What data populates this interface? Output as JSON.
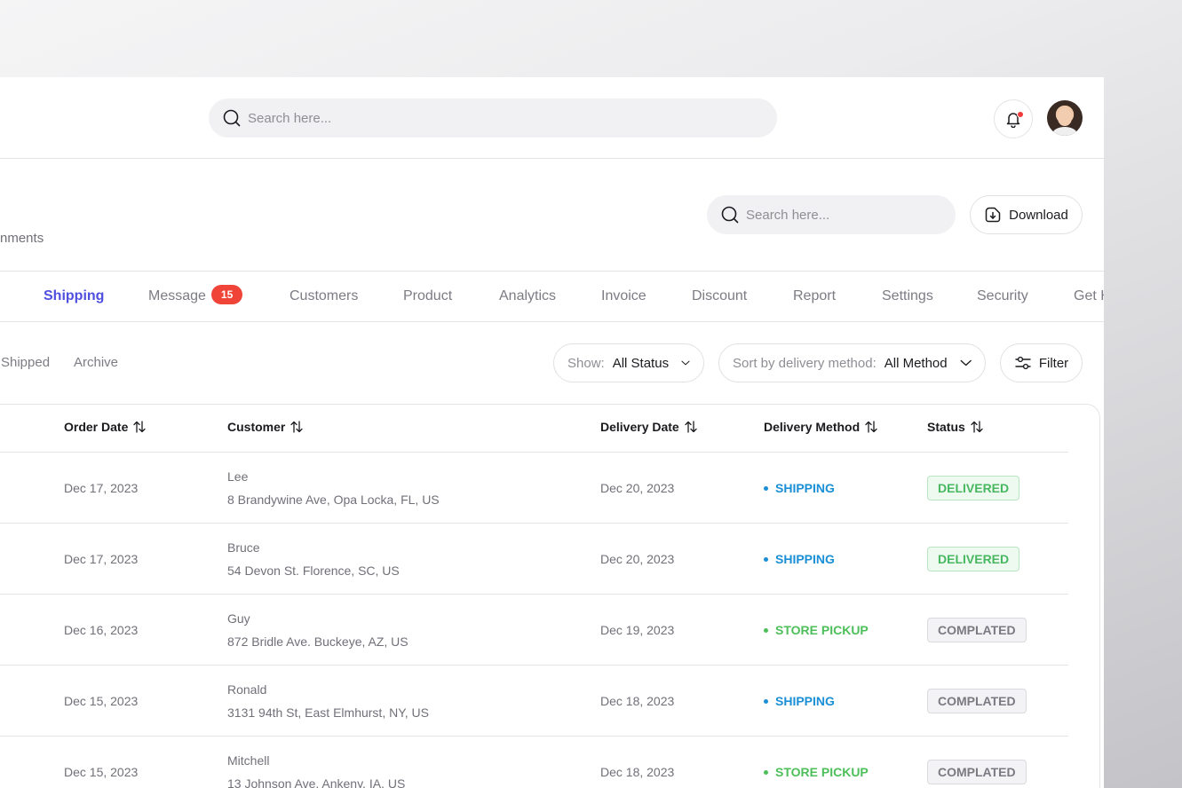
{
  "topbar": {
    "search_placeholder": "Search here...",
    "icons": {
      "search": "search-icon",
      "notification": "bell-icon",
      "avatar": "user-avatar"
    },
    "notification_dot_color": "#ef3b3b"
  },
  "header": {
    "subtitle": "nments",
    "search_placeholder": "Search here...",
    "download_label": "Download"
  },
  "tabs": [
    {
      "label": "Shipping",
      "active": true
    },
    {
      "label": "Message",
      "badge": "15"
    },
    {
      "label": "Customers"
    },
    {
      "label": "Product"
    },
    {
      "label": "Analytics"
    },
    {
      "label": "Invoice"
    },
    {
      "label": "Discount"
    },
    {
      "label": "Report"
    },
    {
      "label": "Settings"
    },
    {
      "label": "Security"
    },
    {
      "label": "Get H"
    }
  ],
  "subtabs": [
    "Shipped",
    "Archive"
  ],
  "filters": {
    "show_label": "Show:",
    "show_value": "All Status",
    "sort_label": "Sort by delivery method:",
    "sort_value": "All Method",
    "filter_label": "Filter"
  },
  "table": {
    "columns": [
      "Order Date",
      "Customer",
      "Delivery Date",
      "Delivery Method",
      "Status"
    ],
    "rows": [
      {
        "order_date": "Dec 17, 2023",
        "customer": "Lee",
        "address": "8 Brandywine Ave, Opa Locka, FL, US",
        "delivery_date": "Dec 20, 2023",
        "method": "SHIPPING",
        "status": "DELIVERED"
      },
      {
        "order_date": "Dec 17, 2023",
        "customer": "Bruce",
        "address": "54 Devon St. Florence, SC, US",
        "delivery_date": "Dec 20, 2023",
        "method": "SHIPPING",
        "status": "DELIVERED"
      },
      {
        "order_date": "Dec 16, 2023",
        "customer": "Guy",
        "address": "872 Bridle Ave. Buckeye, AZ, US",
        "delivery_date": "Dec 19, 2023",
        "method": "STORE PICKUP",
        "status": "COMPLATED"
      },
      {
        "order_date": "Dec 15, 2023",
        "customer": "Ronald",
        "address": "3131 94th St, East Elmhurst, NY, US",
        "delivery_date": "Dec 18, 2023",
        "method": "SHIPPING",
        "status": "COMPLATED"
      },
      {
        "order_date": "Dec 15, 2023",
        "customer": "Mitchell",
        "address": "13 Johnson Ave. Ankeny, IA, US",
        "delivery_date": "Dec 18, 2023",
        "method": "STORE PICKUP",
        "status": "COMPLATED"
      }
    ]
  },
  "colors": {
    "accent": "#4f4fe0",
    "shipping": "#1a8fd6",
    "store_pickup": "#4cbf5a",
    "delivered_text": "#47b861",
    "delivered_bg": "#eef9f0",
    "delivered_border": "#b9e6c2",
    "completed_text": "#7a7a82",
    "completed_bg": "#f3f3f5",
    "completed_border": "#dadade"
  }
}
